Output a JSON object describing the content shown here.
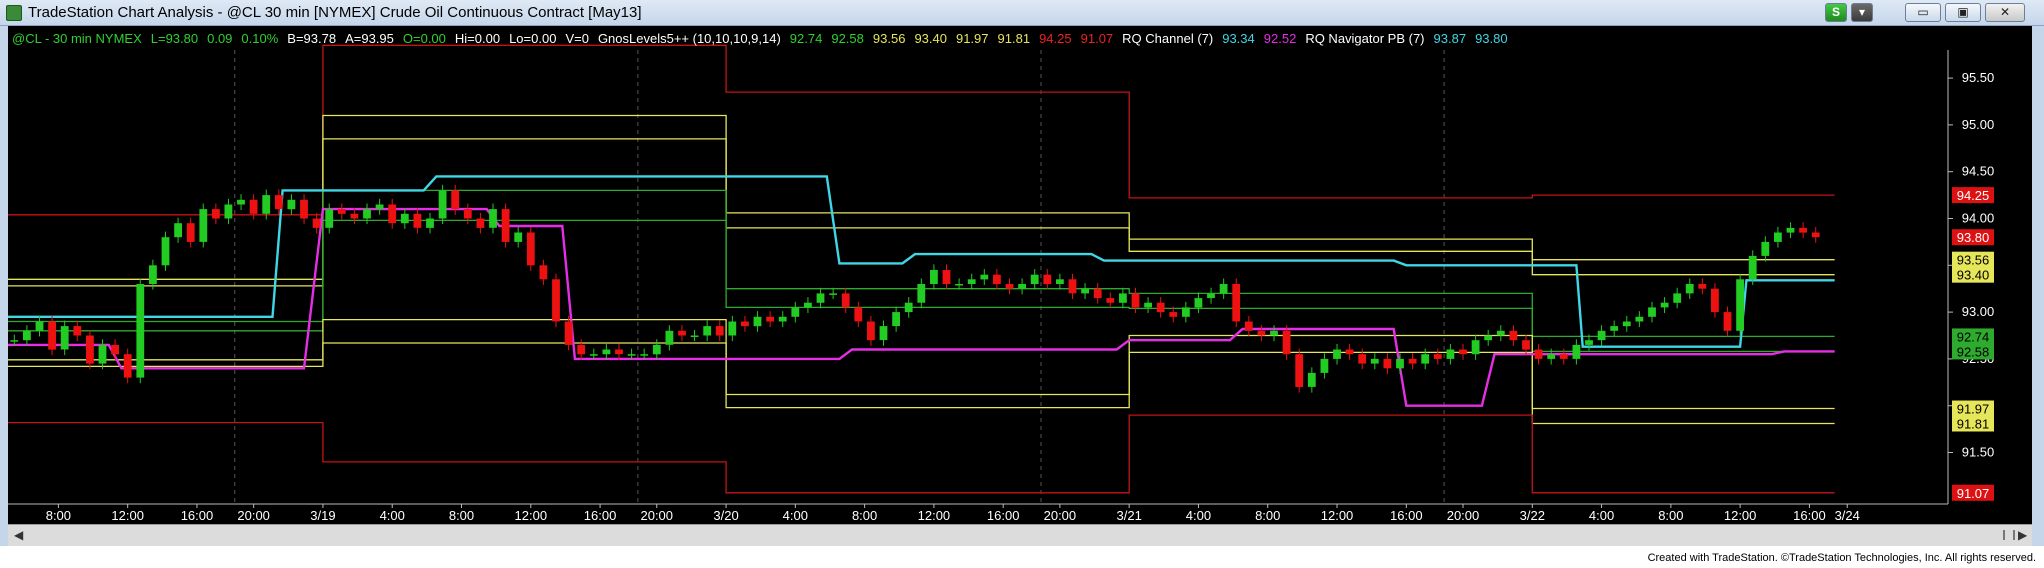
{
  "window": {
    "title": "TradeStation Chart Analysis - @CL 30 min [NYMEX] Crude Oil Continuous Contract [May13]",
    "btn_s": "S",
    "btn_menu": "▾",
    "btn_min": "▭",
    "btn_max": "▣",
    "btn_close": "✕"
  },
  "footer": "Created with TradeStation. ©TradeStation Technologies, Inc. All rights reserved.",
  "colors": {
    "bg": "#000000",
    "price_up": "#22cc22",
    "price_down": "#ee1111",
    "yellow": "#e6e65a",
    "green": "#2eaa2e",
    "red": "#c41414",
    "cyan": "#3fd6e6",
    "magenta": "#e52ee5"
  },
  "chart_data": {
    "type": "line",
    "title": "",
    "info_items": [
      {
        "text": "@CL - 30 min NYMEX",
        "color": "#2fd02f"
      },
      {
        "text": "L=93.80",
        "color": "#2fd02f"
      },
      {
        "text": "0.09",
        "color": "#2fd02f"
      },
      {
        "text": "0.10%",
        "color": "#2fd02f"
      },
      {
        "text": "B=93.78",
        "color": "#ffffff"
      },
      {
        "text": "A=93.95",
        "color": "#ffffff"
      },
      {
        "text": "O=0.00",
        "color": "#2fd02f"
      },
      {
        "text": "Hi=0.00",
        "color": "#ffffff"
      },
      {
        "text": "Lo=0.00",
        "color": "#ffffff"
      },
      {
        "text": "V=0",
        "color": "#ffffff"
      },
      {
        "text": "GnosLevels5++ (10,10,10,9,14)",
        "color": "#ffffff"
      },
      {
        "text": "92.74",
        "color": "#2fd02f"
      },
      {
        "text": "92.58",
        "color": "#2fd02f"
      },
      {
        "text": "93.56",
        "color": "#e6e65a"
      },
      {
        "text": "93.40",
        "color": "#e6e65a"
      },
      {
        "text": "91.97",
        "color": "#e6e65a"
      },
      {
        "text": "91.81",
        "color": "#e6e65a"
      },
      {
        "text": "94.25",
        "color": "#ee2222"
      },
      {
        "text": "91.07",
        "color": "#ee2222"
      },
      {
        "text": "RQ  Channel (7)",
        "color": "#ffffff"
      },
      {
        "text": "93.34",
        "color": "#3fd6e6"
      },
      {
        "text": "92.52",
        "color": "#e52ee5"
      },
      {
        "text": "RQ Navigator PB (7)",
        "color": "#ffffff"
      },
      {
        "text": "93.87",
        "color": "#3fd6e6"
      },
      {
        "text": "93.80",
        "color": "#3fd6e6"
      }
    ],
    "ylim": [
      90.95,
      95.8
    ],
    "xlim": [
      0,
      154
    ],
    "y_ticks": [
      "95.50",
      "95.00",
      "94.50",
      "94.00",
      "93.50",
      "93.00",
      "92.50",
      "92.00",
      "91.50"
    ],
    "x_ticks": [
      {
        "x": 4,
        "label": "8:00"
      },
      {
        "x": 9.5,
        "label": "12:00"
      },
      {
        "x": 15,
        "label": "16:00"
      },
      {
        "x": 19.5,
        "label": "20:00"
      },
      {
        "x": 25,
        "label": "3/19"
      },
      {
        "x": 30.5,
        "label": "4:00"
      },
      {
        "x": 36,
        "label": "8:00"
      },
      {
        "x": 41.5,
        "label": "12:00"
      },
      {
        "x": 47,
        "label": "16:00"
      },
      {
        "x": 51.5,
        "label": "20:00"
      },
      {
        "x": 57,
        "label": "3/20"
      },
      {
        "x": 62.5,
        "label": "4:00"
      },
      {
        "x": 68,
        "label": "8:00"
      },
      {
        "x": 73.5,
        "label": "12:00"
      },
      {
        "x": 79,
        "label": "16:00"
      },
      {
        "x": 83.5,
        "label": "20:00"
      },
      {
        "x": 89,
        "label": "3/21"
      },
      {
        "x": 94.5,
        "label": "4:00"
      },
      {
        "x": 100,
        "label": "8:00"
      },
      {
        "x": 105.5,
        "label": "12:00"
      },
      {
        "x": 111,
        "label": "16:00"
      },
      {
        "x": 115.5,
        "label": "20:00"
      },
      {
        "x": 121,
        "label": "3/22"
      },
      {
        "x": 126.5,
        "label": "4:00"
      },
      {
        "x": 132,
        "label": "8:00"
      },
      {
        "x": 137.5,
        "label": "12:00"
      },
      {
        "x": 143,
        "label": "16:00"
      },
      {
        "x": 146,
        "label": "3/24"
      }
    ],
    "session_breaks": [
      18,
      50,
      82,
      114
    ],
    "price_tags": [
      {
        "value": 94.25,
        "label": "94.25",
        "bg": "#dd1111",
        "fg": "#ffffff"
      },
      {
        "value": 93.8,
        "label": "93.80",
        "bg": "#dd1111",
        "fg": "#ffffff"
      },
      {
        "value": 93.56,
        "label": "93.56",
        "bg": "#e6e65a",
        "fg": "#000000"
      },
      {
        "value": 93.4,
        "label": "93.40",
        "bg": "#e6e65a",
        "fg": "#000000"
      },
      {
        "value": 92.74,
        "label": "92.74",
        "bg": "#2eaa2e",
        "fg": "#000000"
      },
      {
        "value": 92.58,
        "label": "92.58",
        "bg": "#2eaa2e",
        "fg": "#000000"
      },
      {
        "value": 91.97,
        "label": "91.97",
        "bg": "#e6e65a",
        "fg": "#000000"
      },
      {
        "value": 91.81,
        "label": "91.81",
        "bg": "#e6e65a",
        "fg": "#000000"
      },
      {
        "value": 91.07,
        "label": "91.07",
        "bg": "#dd1111",
        "fg": "#ffffff"
      }
    ],
    "levels": [
      {
        "color": "#c41414",
        "segments": [
          [
            0,
            25,
            94.04
          ],
          [
            25,
            57,
            95.85
          ],
          [
            57,
            89,
            95.35
          ],
          [
            89,
            121,
            94.22
          ],
          [
            121,
            145,
            94.25
          ]
        ]
      },
      {
        "color": "#e6e65a",
        "segments": [
          [
            0,
            25,
            93.35
          ],
          [
            25,
            57,
            95.1
          ],
          [
            57,
            89,
            94.06
          ],
          [
            89,
            121,
            93.78
          ],
          [
            121,
            145,
            93.56
          ]
        ]
      },
      {
        "color": "#e6e65a",
        "segments": [
          [
            0,
            25,
            93.28
          ],
          [
            25,
            57,
            94.85
          ],
          [
            57,
            89,
            93.9
          ],
          [
            89,
            121,
            93.65
          ],
          [
            121,
            145,
            93.4
          ]
        ]
      },
      {
        "color": "#2eaa2e",
        "segments": [
          [
            0,
            25,
            92.9
          ],
          [
            25,
            57,
            94.3
          ],
          [
            57,
            89,
            93.25
          ],
          [
            89,
            121,
            93.2
          ],
          [
            121,
            145,
            92.74
          ]
        ]
      },
      {
        "color": "#2eaa2e",
        "segments": [
          [
            0,
            25,
            92.8
          ],
          [
            25,
            57,
            93.98
          ],
          [
            57,
            89,
            93.05
          ],
          [
            89,
            121,
            93.04
          ],
          [
            121,
            145,
            92.58
          ]
        ]
      },
      {
        "color": "#e6e65a",
        "segments": [
          [
            0,
            25,
            92.49
          ],
          [
            25,
            57,
            92.92
          ],
          [
            57,
            89,
            92.12
          ],
          [
            89,
            121,
            92.75
          ],
          [
            121,
            145,
            91.97
          ]
        ]
      },
      {
        "color": "#e6e65a",
        "segments": [
          [
            0,
            25,
            92.42
          ],
          [
            25,
            57,
            92.67
          ],
          [
            57,
            89,
            91.98
          ],
          [
            89,
            121,
            92.57
          ],
          [
            121,
            145,
            91.81
          ]
        ]
      },
      {
        "color": "#c41414",
        "segments": [
          [
            0,
            25,
            91.82
          ],
          [
            25,
            57,
            91.4
          ],
          [
            57,
            89,
            91.07
          ],
          [
            89,
            121,
            91.9
          ],
          [
            121,
            145,
            91.07
          ]
        ]
      }
    ],
    "cyan_channel": [
      [
        0,
        92.95
      ],
      [
        21,
        92.95
      ],
      [
        21.8,
        94.3
      ],
      [
        33,
        94.3
      ],
      [
        34,
        94.45
      ],
      [
        65,
        94.45
      ],
      [
        66,
        93.52
      ],
      [
        71,
        93.52
      ],
      [
        72,
        93.62
      ],
      [
        86,
        93.62
      ],
      [
        87,
        93.55
      ],
      [
        110,
        93.55
      ],
      [
        111,
        93.5
      ],
      [
        124.5,
        93.5
      ],
      [
        125,
        92.63
      ],
      [
        137.5,
        92.63
      ],
      [
        138,
        93.34
      ],
      [
        145,
        93.34
      ]
    ],
    "magenta_channel": [
      [
        0,
        92.65
      ],
      [
        8,
        92.65
      ],
      [
        9,
        92.4
      ],
      [
        23.5,
        92.4
      ],
      [
        25,
        94.1
      ],
      [
        38,
        94.1
      ],
      [
        39,
        93.92
      ],
      [
        44,
        93.92
      ],
      [
        45,
        92.5
      ],
      [
        66,
        92.5
      ],
      [
        67,
        92.6
      ],
      [
        88,
        92.6
      ],
      [
        89,
        92.7
      ],
      [
        97,
        92.7
      ],
      [
        98,
        92.82
      ],
      [
        110,
        92.82
      ],
      [
        111,
        92.0
      ],
      [
        117,
        92.0
      ],
      [
        118,
        92.55
      ],
      [
        140,
        92.55
      ],
      [
        141,
        92.58
      ],
      [
        145,
        92.58
      ]
    ],
    "close": [
      92.7,
      92.8,
      92.9,
      92.6,
      92.85,
      92.75,
      92.45,
      92.65,
      92.55,
      92.3,
      93.3,
      93.5,
      93.8,
      93.95,
      93.75,
      94.1,
      94.0,
      94.15,
      94.2,
      94.05,
      94.25,
      94.1,
      94.2,
      94.0,
      93.9,
      94.1,
      94.05,
      94.0,
      94.1,
      94.15,
      93.95,
      94.05,
      93.9,
      94.0,
      94.3,
      94.1,
      94.0,
      93.9,
      94.1,
      93.75,
      93.85,
      93.5,
      93.35,
      92.9,
      92.65,
      92.55,
      92.55,
      92.6,
      92.55,
      92.55,
      92.55,
      92.65,
      92.8,
      92.75,
      92.75,
      92.85,
      92.75,
      92.9,
      92.85,
      92.95,
      92.9,
      92.95,
      93.05,
      93.1,
      93.2,
      93.2,
      93.05,
      92.9,
      92.7,
      92.85,
      93.0,
      93.1,
      93.3,
      93.45,
      93.3,
      93.3,
      93.35,
      93.4,
      93.3,
      93.25,
      93.3,
      93.4,
      93.3,
      93.35,
      93.2,
      93.25,
      93.15,
      93.1,
      93.2,
      93.05,
      93.1,
      93.0,
      92.95,
      93.05,
      93.15,
      93.2,
      93.3,
      92.9,
      92.8,
      92.75,
      92.8,
      92.55,
      92.2,
      92.35,
      92.5,
      92.6,
      92.55,
      92.45,
      92.5,
      92.4,
      92.5,
      92.45,
      92.55,
      92.5,
      92.6,
      92.55,
      92.7,
      92.75,
      92.8,
      92.7,
      92.6,
      92.5,
      92.55,
      92.5,
      92.65,
      92.7,
      92.8,
      92.85,
      92.9,
      92.95,
      93.05,
      93.1,
      93.2,
      93.3,
      93.25,
      93.0,
      92.8,
      93.35,
      93.6,
      93.75,
      93.85,
      93.9,
      93.85,
      93.8
    ]
  }
}
